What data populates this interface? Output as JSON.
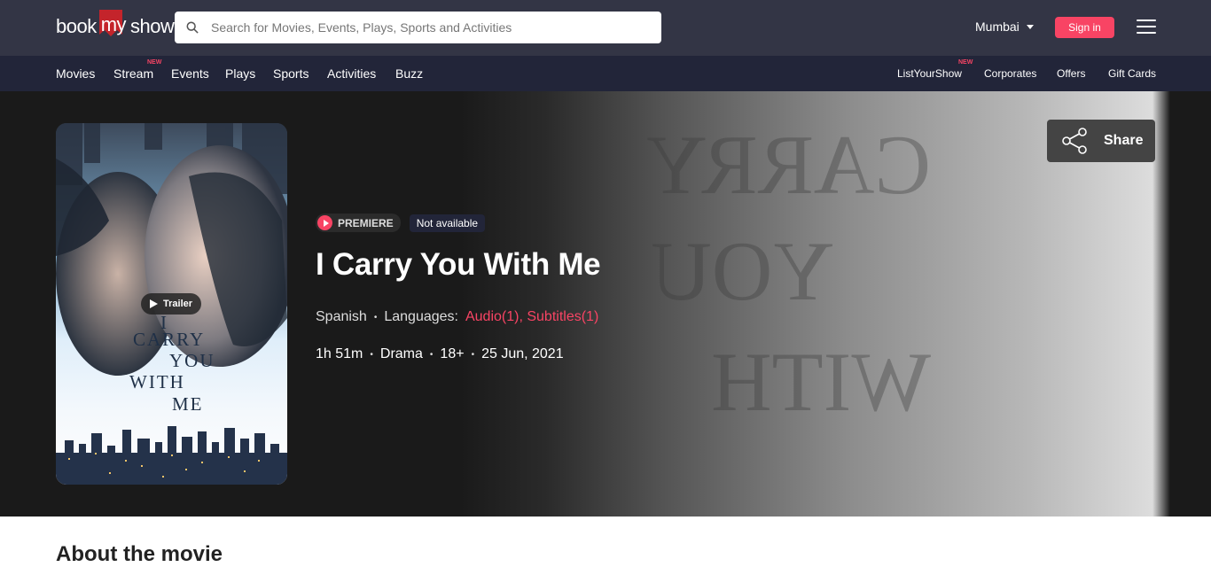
{
  "header": {
    "logo": {
      "part1": "book",
      "part2": "my",
      "part3": "show"
    },
    "search_placeholder": "Search for Movies, Events, Plays, Sports and Activities",
    "city": "Mumbai",
    "signin_label": "Sign in"
  },
  "nav": {
    "left": [
      {
        "label": "Movies"
      },
      {
        "label": "Stream",
        "badge": "NEW"
      },
      {
        "label": "Events"
      },
      {
        "label": "Plays"
      },
      {
        "label": "Sports"
      },
      {
        "label": "Activities"
      },
      {
        "label": "Buzz"
      }
    ],
    "right": [
      {
        "label": "ListYourShow",
        "badge": "NEW"
      },
      {
        "label": "Corporates"
      },
      {
        "label": "Offers"
      },
      {
        "label": "Gift Cards"
      }
    ]
  },
  "movie": {
    "poster_text": [
      "I",
      "CARRY",
      "YOU",
      "WITH",
      "ME"
    ],
    "trailer_label": "Trailer",
    "premiere_label": "PREMIERE",
    "availability": "Not available",
    "title": "I Carry You With Me",
    "language": "Spanish",
    "languages_label": "Languages:",
    "languages_value": "Audio(1), Subtitles(1)",
    "duration": "1h 51m",
    "genre": "Drama",
    "rating": "18+",
    "release_date": "25 Jun, 2021",
    "bg_ghost_text": [
      "CARRY",
      "YOU",
      "WITH"
    ]
  },
  "share_label": "Share",
  "about_heading": "About the movie",
  "colors": {
    "accent": "#f84464",
    "topbar": "#333545",
    "navbar": "#222539"
  }
}
